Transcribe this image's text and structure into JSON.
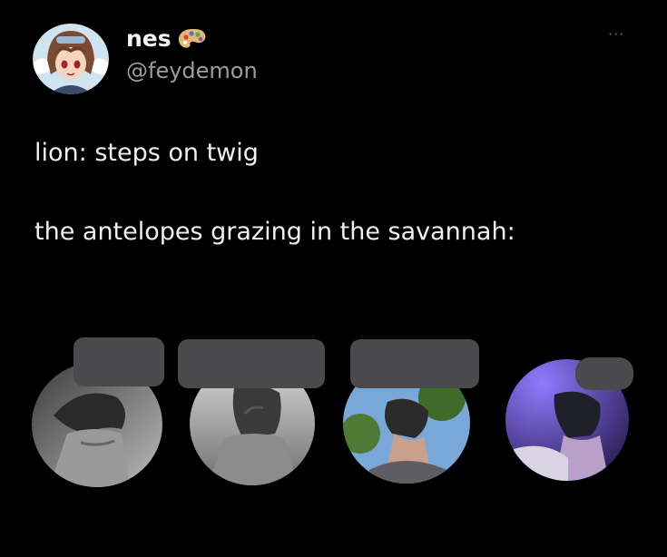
{
  "author": {
    "display_name": "nes",
    "handle": "@feydemon",
    "name_emoji_icon": "palette-icon",
    "avatar_icon": "anime-avatar-icon"
  },
  "more_label": "···",
  "tweet": {
    "lines": [
      "lion: steps on twig",
      "the antelopes grazing in the savannah:"
    ]
  },
  "photos": [
    {
      "desc_icon": "grayscale-neck-photo-icon"
    },
    {
      "desc_icon": "grayscale-neck-photo-icon"
    },
    {
      "desc_icon": "outdoor-neck-photo-icon"
    },
    {
      "desc_icon": "purple-neck-photo-icon"
    }
  ],
  "colors": {
    "background": "#000000",
    "text_primary": "#eef0f1",
    "text_secondary": "#9a9da1",
    "censor_box": "#4a4a4c"
  }
}
